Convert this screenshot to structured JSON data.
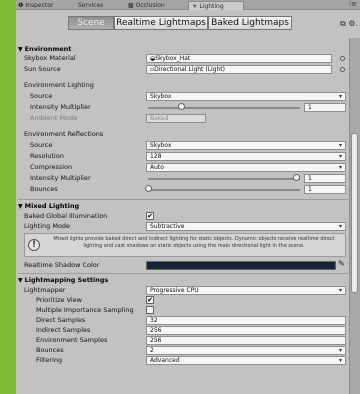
{
  "window_tabs": [
    {
      "label": "Inspector",
      "icon": "info-icon",
      "glyph": "❶"
    },
    {
      "label": "Services",
      "icon": "",
      "glyph": ""
    },
    {
      "label": "Occlusion",
      "icon": "occlusion-icon",
      "glyph": "▩"
    },
    {
      "label": "Lighting",
      "icon": "sun-icon",
      "glyph": "☀"
    }
  ],
  "toolbar": {
    "tabs": [
      "Scene",
      "Realtime Lightmaps",
      "Baked Lightmaps"
    ],
    "active_tab": "Scene"
  },
  "environment": {
    "header": "Environment",
    "skybox_material_label": "Skybox Material",
    "skybox_material_value": "Skybox_Hat",
    "sun_source_label": "Sun Source",
    "sun_source_value": "Directional Light (Light)",
    "lighting_header": "Environment Lighting",
    "source_label": "Source",
    "source_value": "Skybox",
    "intensity_label": "Intensity Multiplier",
    "intensity_value": "1",
    "intensity_level": 0.22,
    "ambient_mode_label": "Ambient Mode",
    "ambient_mode_value": "Baked",
    "reflections_header": "Environment Reflections",
    "refl_source_label": "Source",
    "refl_source_value": "Skybox",
    "resolution_label": "Resolution",
    "resolution_value": "128",
    "compression_label": "Compression",
    "compression_value": "Auto",
    "refl_intensity_label": "Intensity Multiplier",
    "refl_intensity_value": "1",
    "refl_intensity_level": 1.0,
    "bounces_label": "Bounces",
    "bounces_value": "1",
    "bounces_level": 0.0
  },
  "mixed_lighting": {
    "header": "Mixed Lighting",
    "baked_gi_label": "Baked Global Illumination",
    "baked_gi_checked": true,
    "lighting_mode_label": "Lighting Mode",
    "lighting_mode_value": "Subtractive",
    "info_text": "Mixed lights provide baked direct and indirect lighting for static objects. Dynamic objects receive realtime direct lighting and cast shadows on static objects using the main directional light in the scene.",
    "shadow_color_label": "Realtime Shadow Color",
    "shadow_color": "#152339"
  },
  "lightmapping": {
    "header": "Lightmapping Settings",
    "lightmapper_label": "Lightmapper",
    "lightmapper_value": "Progressive CPU",
    "prioritize_label": "Prioritize View",
    "prioritize_checked": true,
    "mis_label": "Multiple Importance Sampling",
    "mis_checked": false,
    "direct_label": "Direct Samples",
    "direct_value": "32",
    "indirect_label": "Indirect Samples",
    "indirect_value": "256",
    "env_samples_label": "Environment Samples",
    "env_samples_value": "256",
    "bounces_label": "Bounces",
    "bounces_value": "2",
    "filtering_label": "Filtering",
    "filtering_value": "Advanced"
  },
  "colors": {
    "accent_green": "#7dbb35",
    "panel_bg": "#c2c2c2"
  }
}
